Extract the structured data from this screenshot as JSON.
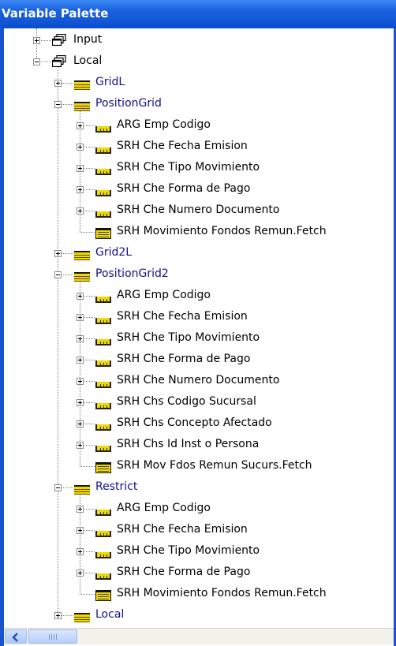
{
  "window": {
    "title": "Variable Palette"
  },
  "tree": [
    {
      "label": "Input",
      "type": "object",
      "state": "plus",
      "level": 1,
      "color": "black"
    },
    {
      "label": "Local",
      "type": "object",
      "state": "minus",
      "level": 1,
      "color": "black"
    },
    {
      "label": "GridL",
      "type": "grid",
      "state": "plus",
      "level": 2,
      "color": "blue"
    },
    {
      "label": "PositionGrid",
      "type": "grid",
      "state": "minus",
      "level": 2,
      "color": "blue"
    },
    {
      "label": "ARG Emp Codigo",
      "type": "field",
      "state": "plus",
      "level": 3,
      "color": "black"
    },
    {
      "label": "SRH Che Fecha Emision",
      "type": "field",
      "state": "plus",
      "level": 3,
      "color": "black"
    },
    {
      "label": "SRH Che Tipo Movimiento",
      "type": "field",
      "state": "plus",
      "level": 3,
      "color": "black"
    },
    {
      "label": "SRH Che Forma de Pago",
      "type": "field",
      "state": "plus",
      "level": 3,
      "color": "black"
    },
    {
      "label": "SRH Che Numero Documento",
      "type": "field",
      "state": "plus",
      "level": 3,
      "color": "black"
    },
    {
      "label": "SRH Movimiento Fondos Remun.Fetch",
      "type": "table",
      "state": "none",
      "level": 3,
      "color": "black"
    },
    {
      "label": "Grid2L",
      "type": "grid",
      "state": "plus",
      "level": 2,
      "color": "blue"
    },
    {
      "label": "PositionGrid2",
      "type": "grid",
      "state": "minus",
      "level": 2,
      "color": "blue"
    },
    {
      "label": "ARG Emp Codigo",
      "type": "field",
      "state": "plus",
      "level": 3,
      "color": "black"
    },
    {
      "label": "SRH Che Fecha Emision",
      "type": "field",
      "state": "plus",
      "level": 3,
      "color": "black"
    },
    {
      "label": "SRH Che Tipo Movimiento",
      "type": "field",
      "state": "plus",
      "level": 3,
      "color": "black"
    },
    {
      "label": "SRH Che Forma de Pago",
      "type": "field",
      "state": "plus",
      "level": 3,
      "color": "black"
    },
    {
      "label": "SRH Che Numero Documento",
      "type": "field",
      "state": "plus",
      "level": 3,
      "color": "black"
    },
    {
      "label": "SRH Chs Codigo Sucursal",
      "type": "field",
      "state": "plus",
      "level": 3,
      "color": "black"
    },
    {
      "label": "SRH Chs Concepto Afectado",
      "type": "field",
      "state": "plus",
      "level": 3,
      "color": "black"
    },
    {
      "label": "SRH Chs Id Inst o Persona",
      "type": "field",
      "state": "plus",
      "level": 3,
      "color": "black"
    },
    {
      "label": "SRH Mov Fdos Remun Sucurs.Fetch",
      "type": "table",
      "state": "none",
      "level": 3,
      "color": "black"
    },
    {
      "label": "Restrict",
      "type": "grid",
      "state": "minus",
      "level": 2,
      "color": "blue"
    },
    {
      "label": "ARG Emp Codigo",
      "type": "field",
      "state": "plus",
      "level": 3,
      "color": "black"
    },
    {
      "label": "SRH Che Fecha Emision",
      "type": "field",
      "state": "plus",
      "level": 3,
      "color": "black"
    },
    {
      "label": "SRH Che Tipo Movimiento",
      "type": "field",
      "state": "plus",
      "level": 3,
      "color": "black"
    },
    {
      "label": "SRH Che Forma de Pago",
      "type": "field",
      "state": "plus",
      "level": 3,
      "color": "black"
    },
    {
      "label": "SRH Movimiento Fondos Remun.Fetch",
      "type": "table",
      "state": "none",
      "level": 3,
      "color": "black"
    },
    {
      "label": "Local",
      "type": "grid",
      "state": "plus",
      "level": 2,
      "color": "blue"
    }
  ],
  "colors": {
    "title_bar": "#1d63e0",
    "grid_label": "#10108c",
    "icon_yellow": "#f0d800"
  },
  "icons": {
    "object": "object-stack-icon",
    "grid": "grid-variable-icon",
    "field": "field-variable-icon",
    "table": "fetch-table-icon",
    "scroll_left": "scroll-left-arrow-icon"
  }
}
